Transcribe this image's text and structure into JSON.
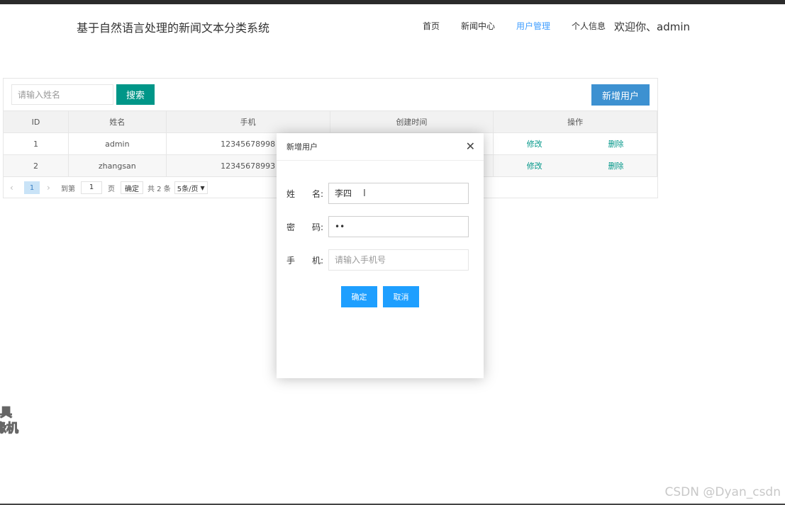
{
  "header": {
    "app_title": "基于自然语言处理的新闻文本分类系统",
    "nav": [
      {
        "label": "首页"
      },
      {
        "label": "新闻中心"
      },
      {
        "label": "用户管理",
        "active": true
      },
      {
        "label": "个人信息"
      }
    ],
    "welcome": "欢迎你、admin",
    "active_color": "#409eff"
  },
  "toolbar": {
    "search_placeholder": "请输入姓名",
    "search_label": "搜索",
    "add_label": "新增用户",
    "search_btn_color": "#009688",
    "add_btn_color": "#3d91d1"
  },
  "table": {
    "columns": [
      "ID",
      "姓名",
      "手机",
      "创建时间",
      "操作"
    ],
    "rows": [
      {
        "id": "1",
        "name": "admin",
        "phone": "12345678998",
        "created": "",
        "edit": "修改",
        "del": "删除"
      },
      {
        "id": "2",
        "name": "zhangsan",
        "phone": "12345678993",
        "created": "",
        "edit": "修改",
        "del": "删除"
      }
    ]
  },
  "pager": {
    "prev_icon": "chevron-left-icon",
    "current_page": "1",
    "next_icon": "chevron-right-icon",
    "goto_label": "到第",
    "goto_value": "1",
    "page_label": "页",
    "confirm_label": "确定",
    "total_label": "共 2 条",
    "page_size": "5条/页"
  },
  "dialog": {
    "title": "新增用户",
    "close_icon": "close-icon",
    "name_label_1": "姓",
    "name_label_2": "名:",
    "name_value": "李四",
    "pwd_label_1": "密",
    "pwd_label_2": "码:",
    "pwd_value": "••",
    "phone_label_1": "手",
    "phone_label_2": "机:",
    "phone_placeholder": "请输入手机号",
    "ok_label": "确定",
    "cancel_label": "取消",
    "btn_color": "#1e9fff"
  },
  "overlay": {
    "line1": "具",
    "line2": "缘机"
  },
  "watermark": "CSDN @Dyan_csdn"
}
